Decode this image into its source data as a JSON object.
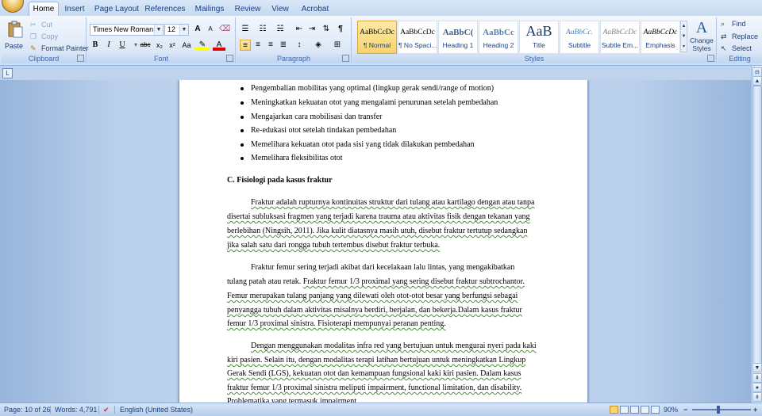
{
  "tabs": [
    {
      "label": "Home",
      "active": true
    },
    {
      "label": "Insert"
    },
    {
      "label": "Page Layout"
    },
    {
      "label": "References"
    },
    {
      "label": "Mailings"
    },
    {
      "label": "Review"
    },
    {
      "label": "View"
    },
    {
      "label": "Acrobat"
    }
  ],
  "clipboard": {
    "paste": "Paste",
    "cut": "Cut",
    "copy": "Copy",
    "format_painter": "Format Painter",
    "label": "Clipboard"
  },
  "font": {
    "family": "Times New Roman",
    "size": "12",
    "bold": "B",
    "italic": "I",
    "underline": "U",
    "strike": "abc",
    "subscript": "x₂",
    "superscript": "x²",
    "change_case": "Aa",
    "font_color_glyph": "A",
    "grow": "A",
    "shrink": "A",
    "label": "Font"
  },
  "paragraph": {
    "label": "Paragraph",
    "pilcrow": "¶"
  },
  "styles": {
    "label": "Styles",
    "tiles": [
      {
        "sample": "AaBbCcDc",
        "name": "¶ Normal",
        "selected": true
      },
      {
        "sample": "AaBbCcDc",
        "name": "¶ No Spaci..."
      },
      {
        "sample": "AaBbC(",
        "name": "Heading 1"
      },
      {
        "sample": "AaBbCc",
        "name": "Heading 2"
      },
      {
        "sample": "AaB",
        "name": "Title"
      },
      {
        "sample": "AaBbCc.",
        "name": "Subtitle"
      },
      {
        "sample": "AaBbCcDc",
        "name": "Subtle Em..."
      },
      {
        "sample": "AaBbCcDc",
        "name": "Emphasis"
      }
    ],
    "change_styles": "Change Styles"
  },
  "editing": {
    "label": "Editing",
    "find": "Find",
    "replace": "Replace",
    "select": "Select"
  },
  "document": {
    "bullets": [
      "Pengembalian mobilitas yang optimal (lingkup gerak sendi/range of motion)",
      "Meningkatkan kekuatan otot yang mengalami penurunan setelah pembedahan",
      "Mengajarkan cara mobilisasi dan transfer",
      "Re-edukasi otot setelah tindakan pembedahan",
      "Memelihara kekuatan otot pada sisi yang tidak dilakukan pembedahan",
      "Memelihara fleksibilitas otot"
    ],
    "heading": "C. Fisiologi pada kasus fraktur",
    "p1": [
      "Fraktur adalah rupturnya kontinuitas struktur dari tulang atau kartilago dengan atau tanpa",
      "disertai subluksasi fragmen yang terjadi karena trauma atau aktivitas fisik dengan tekanan yang",
      "berlebihan (Ningsih, 2011). Jika kulit diatasnya masih utuh, disebut fraktur tertutup sedangkan",
      "jika salah satu dari rongga tubuh tertembus disebut fraktur terbuka."
    ],
    "p2_line1": "Fraktur femur sering terjadi akibat dari kecelakaan lalu lintas, yang  mengakibatkan",
    "p2_line2a": "tulang patah atau retak.",
    "p2_line2b": "Fraktur femur 1/3 proximal yang sering disebut fraktur subtrochantor.",
    "p2_rest": [
      "Femur merupakan tulang panjang yang dilewati oleh otot-otot besar yang berfungsi sebagai",
      "penyangga tubuh dalam aktivitas misalnya berdiri, berjalan, dan bekerja.Dalam kasus fraktur",
      "femur 1/3 proximal sinistra. Fisioterapi mempunyai peranan penting."
    ],
    "p3": [
      "Dengan menggunakan modalitas infra red yang bertujuan untuk mengurai nyeri pada kaki",
      "kiri pasien. Selain itu, dengan modalitas terapi latihan bertujuan untuk meningkatkan Lingkup",
      "Gerak Sendi (LGS), kekuatan otot dan kemampuan fungsional kaki kiri pasien. Dalam kasus",
      "fraktur femur 1/3 proximal sinistra meliputi impairment, functional limitation, dan disability.",
      "Problematika yang termasuk impairment"
    ]
  },
  "status": {
    "page": "Page: 10 of 26",
    "words": "Words: 4,791",
    "language": "English (United States)",
    "zoom": "90%"
  }
}
